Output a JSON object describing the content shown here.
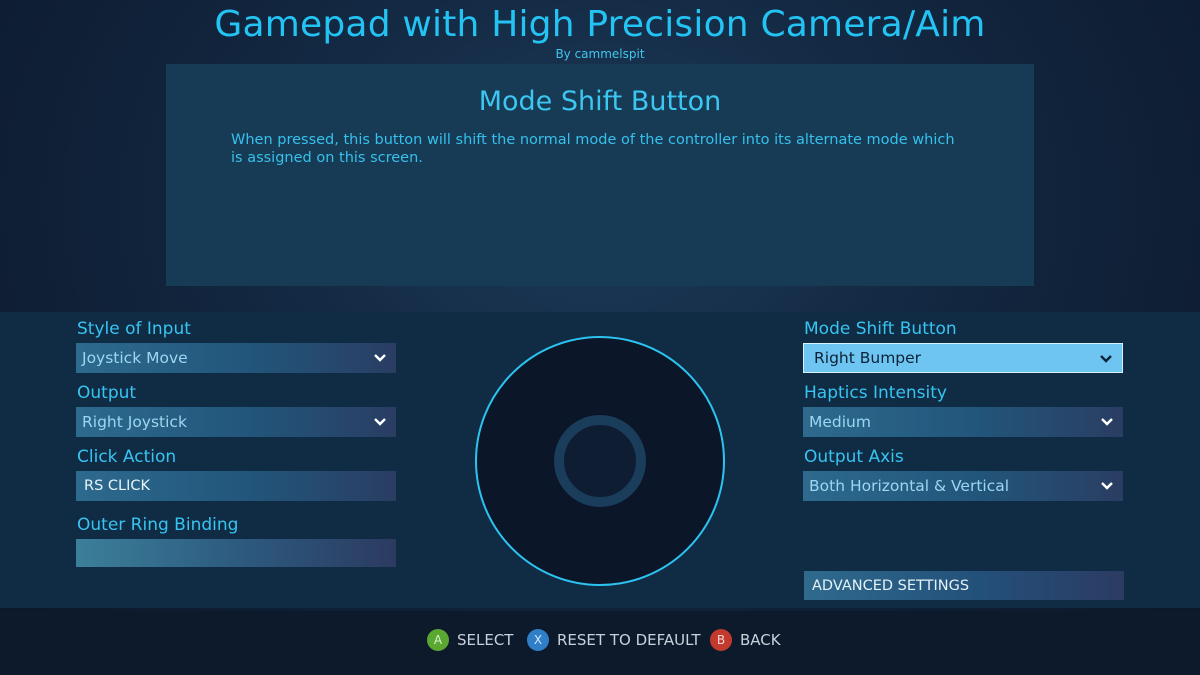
{
  "header": {
    "title": "Gamepad with High Precision Camera/Aim",
    "byline": "By cammelspit"
  },
  "info": {
    "title": "Mode Shift Button",
    "description": "When pressed, this button will shift the normal mode of the controller into its alternate mode which is assigned on this screen."
  },
  "left": {
    "style_label": "Style of Input",
    "style_value": "Joystick Move",
    "output_label": "Output",
    "output_value": "Right Joystick",
    "click_label": "Click Action",
    "click_value": "RS CLICK",
    "ring_label": "Outer Ring Binding",
    "ring_value": ""
  },
  "right": {
    "mode_shift_label": "Mode Shift Button",
    "mode_shift_value": "Right Bumper",
    "haptics_label": "Haptics Intensity",
    "haptics_value": "Medium",
    "axis_label": "Output Axis",
    "axis_value": "Both Horizontal & Vertical",
    "advanced_label": "ADVANCED SETTINGS"
  },
  "footer": {
    "hints": [
      {
        "glyph": "A",
        "label": "SELECT",
        "color": "#5aa832"
      },
      {
        "glyph": "X",
        "label": "RESET TO DEFAULT",
        "color": "#2e7fc8"
      },
      {
        "glyph": "B",
        "label": "BACK",
        "color": "#c2392e"
      }
    ]
  },
  "icons": {
    "dropdown": "chevron-down-icon",
    "stick": "joystick-visual"
  },
  "colors": {
    "accent": "#23c3f4",
    "selected_dropdown": "#6fc5f2",
    "panel": "#173b55"
  }
}
